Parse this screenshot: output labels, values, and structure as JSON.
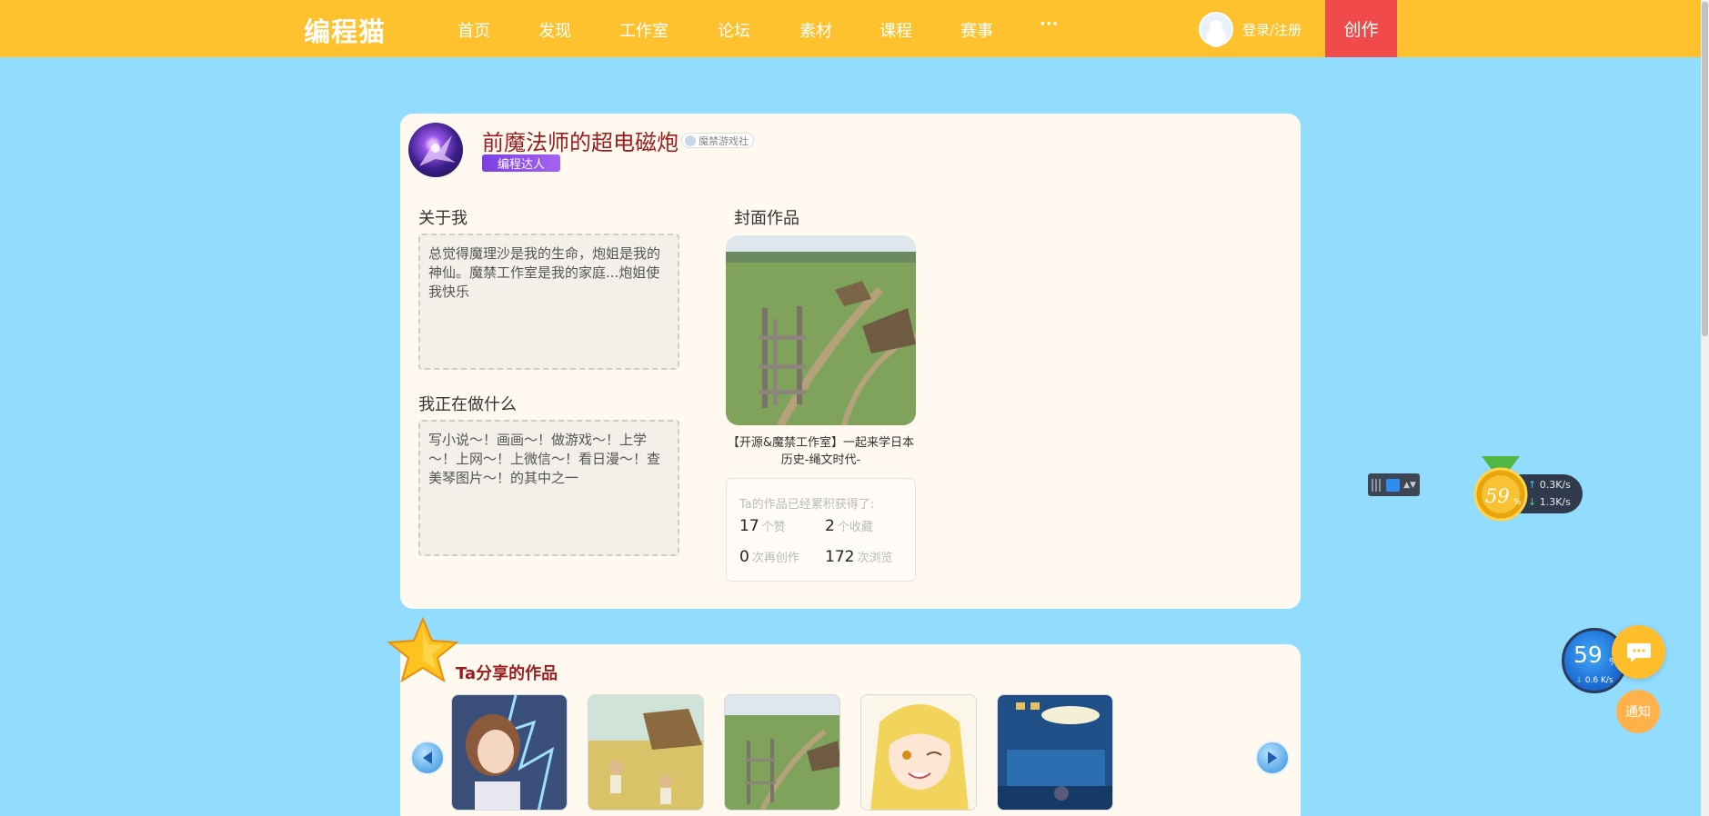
{
  "nav": {
    "logo": "编程猫",
    "items": [
      "首页",
      "发现",
      "工作室",
      "论坛",
      "素材",
      "课程",
      "赛事",
      "···"
    ],
    "login": "登录/注册",
    "create": "创作"
  },
  "profile": {
    "name": "前魔法师的超电磁炮",
    "studio": "魔禁游戏社",
    "title_badge": "编程达人",
    "about_title": "关于我",
    "about_text": "总觉得魔理沙是我的生命，炮姐是我的神仙。魔禁工作室是我的家庭...炮姐使我快乐",
    "doing_title": "我正在做什么",
    "doing_text": "写小说～！画画～！做游戏～！上学～！上网～！上微信～！看日漫～！查美琴图片～！的其中之一",
    "cover_title": "封面作品",
    "cover_caption": "【开源&魔禁工作室】一起来学日本历史-绳文时代-",
    "stats_head": "Ta的作品已经累积获得了:",
    "stats": [
      {
        "value": "17",
        "unit": "个赞"
      },
      {
        "value": "2",
        "unit": "个收藏"
      },
      {
        "value": "0",
        "unit": "次再创作"
      },
      {
        "value": "172",
        "unit": "次浏览"
      }
    ]
  },
  "works": {
    "title": "Ta分享的作品"
  },
  "widgets": {
    "medal_pct": "59",
    "up_speed": "0.3K/s",
    "down_speed": "1.3K/s",
    "net_pct": "59",
    "net_pct_sign": "%",
    "net_speed": "0.6 K/s",
    "notify": "通知"
  },
  "colors": {
    "nav_bg": "#ffc22e",
    "page_bg": "#92dcff",
    "create_bg": "#f14a4a",
    "card_bg": "#fff9ef",
    "name_color": "#9b1d1d",
    "badge_purple": "#7a3fe0"
  }
}
